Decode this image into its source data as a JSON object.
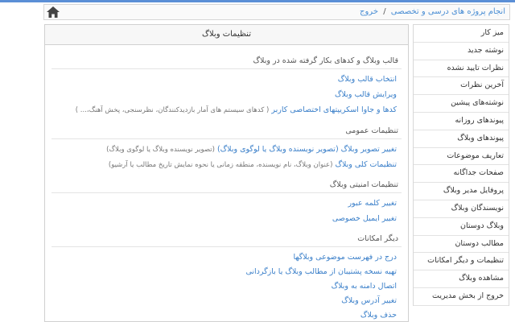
{
  "breadcrumb": {
    "parent": "انجام پروژه های درسی و تخصصی",
    "separator": "/",
    "current": "خروج"
  },
  "main": {
    "title": "تنظیمات وبلاگ",
    "sections": [
      {
        "title": "قالب وبلاگ و کدهای بکار گرفته شده در وبلاگ",
        "items": [
          {
            "label": "انتخاب قالب وبلاگ",
            "desc": ""
          },
          {
            "label": "ویرایش قالب وبلاگ",
            "desc": ""
          },
          {
            "label": "کدها و جاوا اسکریپتهای اختصاصی کاربر",
            "desc": "( کدهای سیستم های آمار بازدیدکنندگان، نظرسنجی، پخش آهنگ،... )"
          }
        ]
      },
      {
        "title": "تنظیمات عمومی",
        "items": [
          {
            "label": "تغییر تصویر وبلاگ (تصویر نویسنده وبلاگ یا لوگوی وبلاگ)",
            "desc": "(تصویر نویسنده وبلاگ یا لوگوی وبلاگ)"
          },
          {
            "label": "تنظیمات کلی وبلاگ",
            "desc": "(عنوان وبلاگ، نام نویسنده، منطقه زمانی یا نحوه نمایش تاریخ مطالب یا آرشیو)"
          }
        ]
      },
      {
        "title": "تنظیمات امنیتی وبلاگ",
        "items": [
          {
            "label": "تغییر کلمه عبور",
            "desc": ""
          },
          {
            "label": "تغییر ایمیل خصوصی",
            "desc": ""
          }
        ]
      },
      {
        "title": "دیگر امکانات",
        "items": [
          {
            "label": "درج در فهرست موضوعی وبلاگها",
            "desc": ""
          },
          {
            "label": "تهیه نسخه پشتیبان از مطالب وبلاگ یا بازگردانی",
            "desc": ""
          },
          {
            "label": "اتصال دامنه به وبلاگ",
            "desc": ""
          },
          {
            "label": "تغییر آدرس وبلاگ",
            "desc": ""
          },
          {
            "label": "حذف وبلاگ",
            "desc": ""
          }
        ]
      }
    ]
  },
  "sidebar": {
    "items": [
      "میز کار",
      "نوشته جدید",
      "نظرات تایید نشده",
      "آخرین نظرات",
      "نوشته‌های پیشین",
      "پیوندهای روزانه",
      "پیوندهای وبلاگ",
      "تعاریف موضوعات",
      "صفحات جداگانه",
      "پروفایل مدیر وبلاگ",
      "نویسندگان وبلاگ",
      "وبلاگ دوستان",
      "مطالب دوستان",
      "تنظیمات و دیگر امکانات",
      "مشاهده وبلاگ",
      "خروج از بخش مدیریت"
    ]
  },
  "icons": {
    "home": "home-icon"
  },
  "colors": {
    "link": "#3a7fc9",
    "accent_line": "#5b8fd6"
  }
}
